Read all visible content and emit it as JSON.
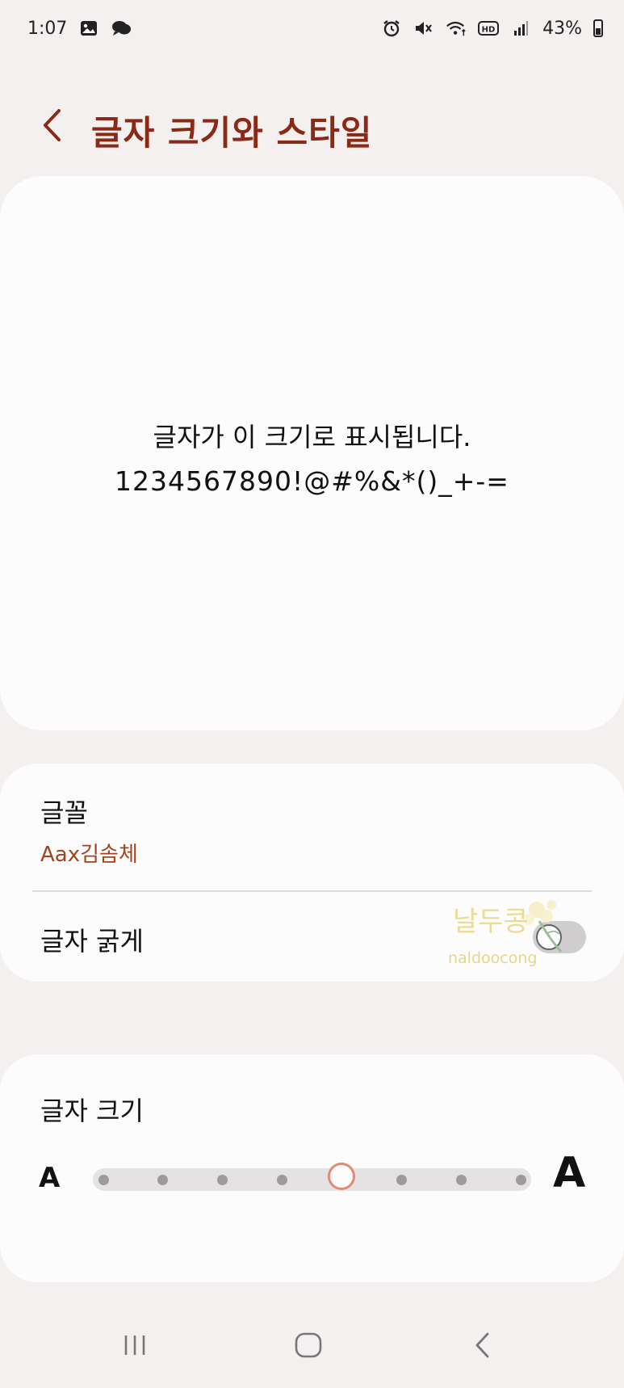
{
  "status": {
    "time": "1:07",
    "battery": "43%",
    "battery_level": 0.43,
    "icons_left": [
      "gallery-icon",
      "chat-icon"
    ],
    "icons_right": [
      "alarm-icon",
      "mute-icon",
      "wifi-icon",
      "hd-icon",
      "signal-icon",
      "battery-icon"
    ]
  },
  "header": {
    "title": "글자 크기와 스타일",
    "title_color": "#8a2a16"
  },
  "preview": {
    "line1": "글자가 이 크기로 표시됩니다.",
    "line2": "1234567890!@#%&*()_+-="
  },
  "font": {
    "label": "글꼴",
    "value": "Aax김솜체",
    "value_color": "#a3431d"
  },
  "bold": {
    "label": "글자 굵게",
    "enabled": false
  },
  "size": {
    "label": "글자 크기",
    "small_a": "A",
    "large_a": "A",
    "steps": 8,
    "current_step": 5,
    "accent_color": "#e28a74"
  },
  "watermark": {
    "text_ko": "날두콩",
    "text_en": "naldoocong"
  },
  "nav": {
    "icons": [
      "recent-apps-icon",
      "home-icon",
      "back-icon"
    ]
  }
}
